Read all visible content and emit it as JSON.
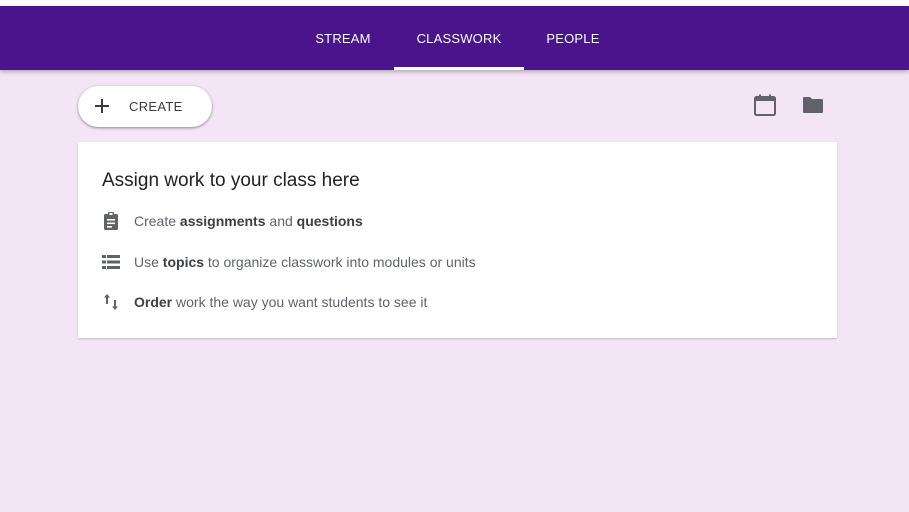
{
  "tabs": [
    {
      "label": "STREAM",
      "active": false
    },
    {
      "label": "CLASSWORK",
      "active": true
    },
    {
      "label": "PEOPLE",
      "active": false
    }
  ],
  "toolbar": {
    "create_label": "CREATE",
    "create_icon": "plus-icon",
    "calendar_icon": "calendar-icon",
    "folder_icon": "folder-icon"
  },
  "card": {
    "title": "Assign work to your class here",
    "rows": [
      {
        "icon": "clipboard-icon",
        "parts": [
          "Create ",
          "assignments",
          " and ",
          "questions"
        ]
      },
      {
        "icon": "list-icon",
        "parts": [
          "Use ",
          "topics",
          " to organize classwork into modules or units"
        ]
      },
      {
        "icon": "sort-arrows-icon",
        "parts": [
          "",
          "Order",
          " work the way you want students to see it"
        ]
      }
    ]
  },
  "colors": {
    "appbar": "#4a148c",
    "background": "#f3e5f5",
    "card": "#ffffff"
  }
}
